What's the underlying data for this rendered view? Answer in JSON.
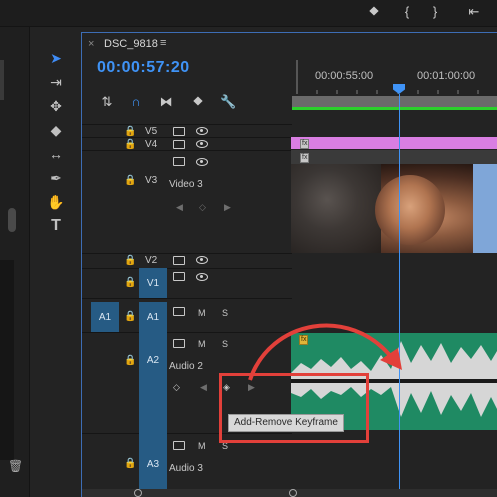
{
  "sequence": {
    "tab_title": "DSC_9818",
    "tab_close_icon": "×",
    "tab_menu_icon": "≡",
    "timecode": "00:00:57:20"
  },
  "ruler": {
    "labels": [
      "00:00:55:00",
      "00:01:00:00"
    ]
  },
  "tracks": {
    "v5": "V5",
    "v4": "V4",
    "v3": "V3",
    "v3_name": "Video 3",
    "v2": "V2",
    "v1": "V1",
    "a1_source": "A1",
    "a1": "A1",
    "a2": "A2",
    "a2_name": "Audio 2",
    "a3": "A3",
    "a3_name": "Audio 3",
    "mute": "M",
    "solo": "S"
  },
  "clips": {
    "fx_label": "fx"
  },
  "tooltip": {
    "text": "Add-Remove Keyframe"
  },
  "colors": {
    "accent": "#3f93f6",
    "patch_blue": "#265b84",
    "v4_clip": "#d97ee2",
    "audio_clip": "#1f8a63",
    "annotation_red": "#e2403a",
    "work_area_green": "#2bd02b"
  },
  "icons": {
    "top": [
      "bookmark-icon",
      "bracket-in-icon",
      "bracket-out-icon",
      "go-to-in-icon"
    ],
    "timeline_toolbar": [
      "nest-icon",
      "snap-icon",
      "linked-selection-icon",
      "marker-icon",
      "wrench-icon"
    ],
    "tools": [
      "selection-tool-icon",
      "track-select-icon",
      "ripple-edit-icon",
      "razor-tool-icon",
      "slip-tool-icon",
      "pen-tool-icon",
      "hand-tool-icon",
      "type-tool-icon"
    ]
  }
}
